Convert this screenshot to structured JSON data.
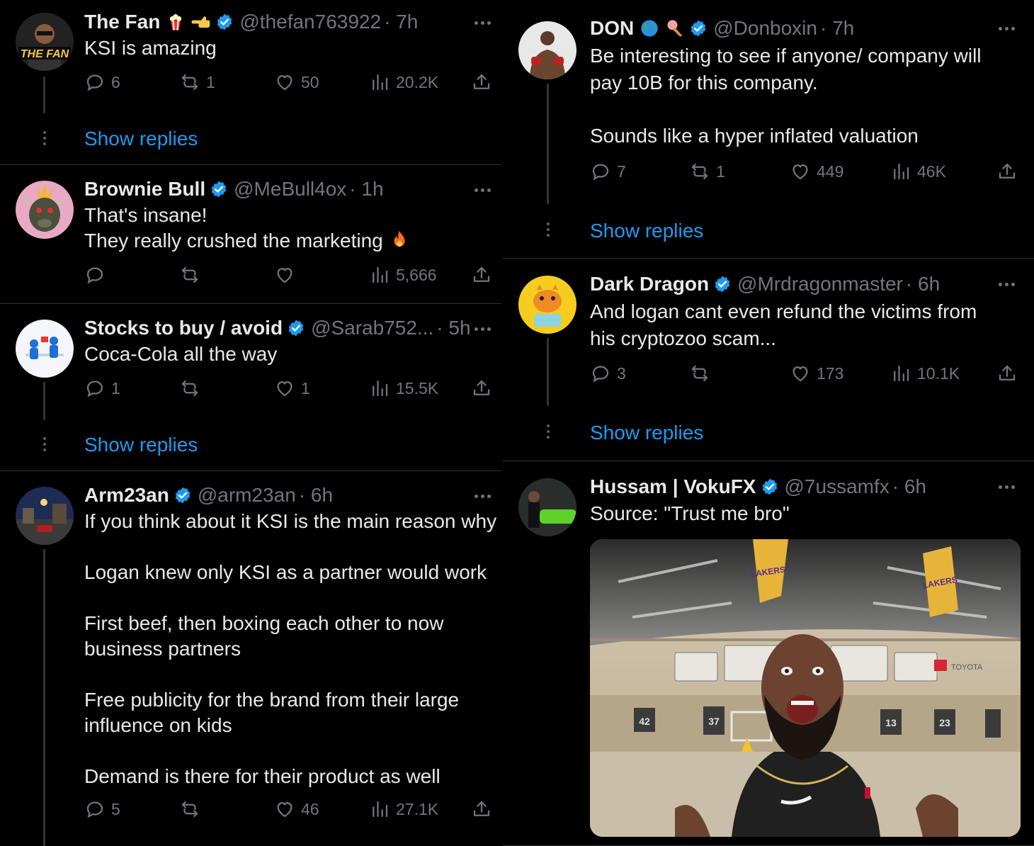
{
  "colors": {
    "background": "#000000",
    "text": "#e7e9ea",
    "muted": "#71767b",
    "accent": "#1d9bf0",
    "verified": "#1d9bf0",
    "separator": "#2f3336"
  },
  "left": {
    "t1": {
      "name": "The Fan",
      "handle": "@thefan763922",
      "time": "· 7h",
      "avatar_text": "THE FAN",
      "emojis": [
        "popcorn-icon",
        "pointing-hand-icon"
      ],
      "text": "KSI is amazing",
      "replies": "6",
      "retweets": "1",
      "likes": "50",
      "views": "20.2K",
      "show_replies": "Show replies"
    },
    "t2": {
      "name": "Brownie Bull",
      "handle": "@MeBull4ox",
      "time": "· 1h",
      "text": "That's insane!\nThey really crushed the marketing",
      "views": "5,666"
    },
    "t3": {
      "name": "Stocks to buy / avoid",
      "handle": "@Sarab752...",
      "time": "· 5h",
      "text": "Coca-Cola all the way",
      "replies": "1",
      "likes": "1",
      "views": "15.5K",
      "show_replies": "Show replies"
    },
    "t4": {
      "name": "Arm23an",
      "handle": "@arm23an",
      "time": "· 6h",
      "text": "If you think about it KSI is the main reason why\n\nLogan knew only KSI as a partner would work\n\nFirst beef, then boxing each other to now\nbusiness partners\n\nFree publicity for the brand from their large\ninfluence on kids\n\nDemand is there for their product as well",
      "replies": "5",
      "likes": "46",
      "views": "27.1K"
    }
  },
  "right": {
    "t1": {
      "name": "DON",
      "handle": "@Donboxin",
      "time": "· 7h",
      "emojis": [
        "globe-icon",
        "ice-cream-icon"
      ],
      "text": "Be interesting to see if anyone/ company will\npay 10B for this company.\n\nSounds like a hyper inflated valuation",
      "replies": "7",
      "retweets": "1",
      "likes": "449",
      "views": "46K",
      "show_replies": "Show replies"
    },
    "t2": {
      "name": "Dark Dragon",
      "handle": "@Mrdragonmaster",
      "time": "· 6h",
      "text": "And logan cant even refund the victims from\nhis cryptozoo scam...",
      "replies": "3",
      "likes": "173",
      "views": "10.1K",
      "show_replies": "Show replies"
    },
    "t3": {
      "name": "Hussam | VokuFX",
      "handle": "@7ussamfx",
      "time": "· 6h",
      "text": "Source: \"Trust me bro\"",
      "media": {
        "banner_text": "LAKERS",
        "sponsor": "TOYOTA",
        "jersey_numbers": [
          "42",
          "37",
          "13",
          "23"
        ]
      }
    }
  }
}
